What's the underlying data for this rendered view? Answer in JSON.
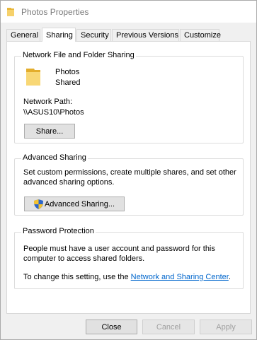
{
  "window": {
    "title": "Photos Properties"
  },
  "tabs": [
    {
      "label": "General"
    },
    {
      "label": "Sharing"
    },
    {
      "label": "Security"
    },
    {
      "label": "Previous Versions"
    },
    {
      "label": "Customize"
    }
  ],
  "network_sharing": {
    "group_label": "Network File and Folder Sharing",
    "folder_name": "Photos",
    "folder_status": "Shared",
    "path_label": "Network Path:",
    "path_value": "\\\\ASUS10\\Photos",
    "share_button": "Share..."
  },
  "advanced_sharing": {
    "group_label": "Advanced Sharing",
    "description_line1": "Set custom permissions, create multiple shares, and set other",
    "description_line2": "advanced sharing options.",
    "button_label": "Advanced Sharing..."
  },
  "password_protection": {
    "group_label": "Password Protection",
    "description_line1": "People must have a user account and password for this",
    "description_line2": "computer to access shared folders.",
    "change_text": "To change this setting, use the ",
    "link_text": "Network and Sharing Center",
    "after_link": "."
  },
  "footer": {
    "close_label": "Close",
    "cancel_label": "Cancel",
    "apply_label": "Apply"
  },
  "colors": {
    "folder": "#f6d16b",
    "link": "#0066cc",
    "tab_active": "#ffffff"
  }
}
